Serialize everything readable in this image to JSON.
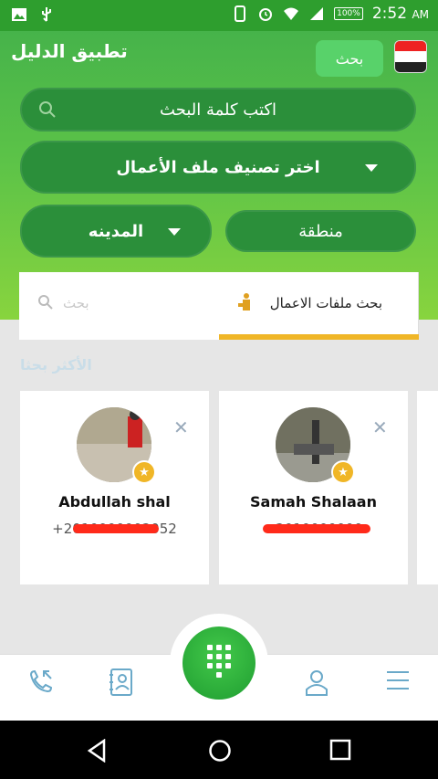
{
  "status_bar": {
    "time": "2:52",
    "ampm": "AM",
    "battery": "100%"
  },
  "header": {
    "app_title": "تطبيق الدليل",
    "search_button": "بحث",
    "search_placeholder": "اكتب كلمة البحث",
    "category_select": "اختر تصنيف ملف الأعمال",
    "city_select": "المدينه",
    "region_select": "منطقة"
  },
  "tabs": {
    "business_search": "بحث ملفات الاعمال",
    "search_placeholder": "بحث"
  },
  "section_title": "الأكثر بحثا",
  "cards": [
    {
      "name": "Abdullah shal",
      "phone": "+2010000002052"
    },
    {
      "name": "Samah Shalaan",
      "phone": "+2010000000"
    }
  ],
  "colors": {
    "primary_green": "#2b8f3a",
    "accent_yellow": "#f0b627"
  }
}
